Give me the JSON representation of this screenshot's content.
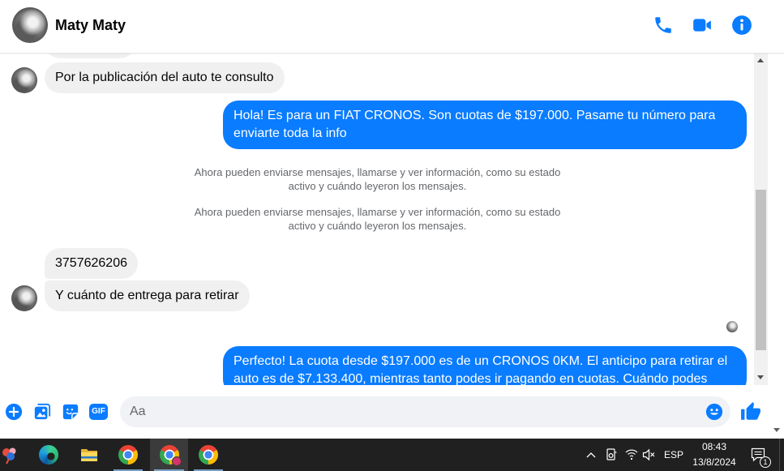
{
  "header": {
    "contact_name": "Maty Maty",
    "action_icons": [
      "phone-icon",
      "video-camera-icon",
      "info-icon"
    ]
  },
  "messages": [
    {
      "text": "Por la publicación del auto te consulto",
      "outgoing": false
    },
    {
      "text": "Hola! Es para un FIAT CRONOS. Son cuotas de $197.000. Pasame tu número para enviarte toda la info",
      "outgoing": true
    },
    {
      "text": "Ahora pueden enviarse mensajes, llamarse y ver información, como su estado activo y cuándo leyeron los mensajes.",
      "system": true
    },
    {
      "text": "Ahora pueden enviarse mensajes, llamarse y ver información, como su estado activo y cuándo leyeron los mensajes.",
      "system": true
    },
    {
      "text": "3757626206",
      "outgoing": false
    },
    {
      "text": "Y cuánto de entrega para retirar",
      "outgoing": false
    },
    {
      "text": "Perfecto! La cuota desde $197.000 es de un CRONOS 0KM. El anticipo para retirar el auto es de $7.133.400, mientras tanto podes ir pagando en cuotas. Cuándo podes",
      "outgoing": true
    }
  ],
  "composer": {
    "placeholder": "Aa",
    "gif_label": "GIF",
    "icons": [
      "plus-icon",
      "image-icon",
      "sticker-icon",
      "gif-icon",
      "emoji-icon",
      "thumbs-up-icon"
    ]
  },
  "taskbar": {
    "app_icons": [
      "pinned-app-icon",
      "edge-icon",
      "file-explorer-icon",
      "chrome-icon",
      "chrome-profile-icon",
      "chrome-icon"
    ],
    "tray": {
      "tray_icons": [
        "chevron-up-icon",
        "meet-now-icon",
        "wifi-icon",
        "volume-muted-icon",
        "notification-icon"
      ],
      "language": "ESP",
      "time": "08:43",
      "date": "13/8/2024",
      "notification_count": "1"
    }
  },
  "colors": {
    "accent": "#0a7cff",
    "incoming_bubble": "#f0f0f0",
    "outgoing_bubble": "#0a7cff",
    "composer_input": "#f0f2f5",
    "system_text": "#65676b",
    "taskbar": "#202020"
  }
}
